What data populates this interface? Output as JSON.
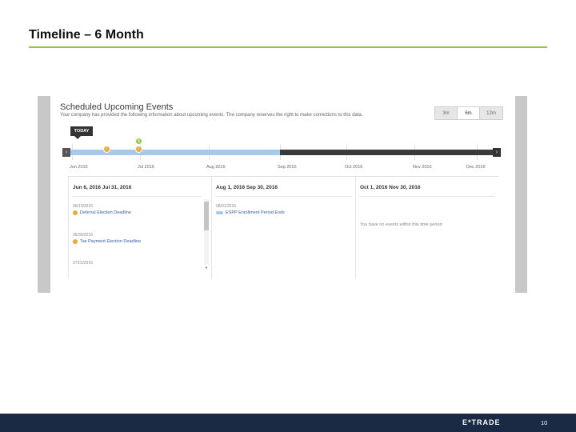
{
  "slide": {
    "title": "Timeline – 6 Month",
    "page_number": "10",
    "logo_text": "E*TRADE"
  },
  "panel": {
    "title": "Scheduled Upcoming Events",
    "subtitle": "Your company has provided the following information about upcoming events. The company reserves the right to make corrections to this data.",
    "range_buttons": [
      "3m",
      "6m",
      "12m"
    ],
    "active_range": "6m",
    "today_label": "TODAY"
  },
  "timeline": {
    "months": [
      "Jun 2016",
      "Jul 2016",
      "Aug 2016",
      "Sep 2016",
      "Oct 2016",
      "Nov 2016",
      "Dec 2016"
    ],
    "markers": [
      {
        "label": "!",
        "type": "warning"
      },
      {
        "label": "!",
        "type": "warning"
      },
      {
        "label": "$",
        "type": "payment"
      }
    ]
  },
  "columns": [
    {
      "header": "Jun 6, 2016   Jul 31, 2016",
      "events": [
        {
          "date": "06/10/2016",
          "label": "Deferral Election Deadline"
        },
        {
          "date": "06/30/2016",
          "label": "Tax Payment Election Deadline"
        },
        {
          "date": "07/01/2016",
          "label": ""
        }
      ]
    },
    {
      "header": "Aug 1, 2016   Sep 30, 2016",
      "events": [
        {
          "date": "08/01/2016",
          "label": "ESPP Enrollment Period Ends"
        }
      ]
    },
    {
      "header": "Oct 1, 2016   Nov 30, 2016",
      "events": [],
      "empty_text": "You have no events within this time period"
    }
  ],
  "colors": {
    "accent_green": "#8dc63f",
    "timeline_blue": "#a7c8ef",
    "marker_orange": "#f0a830",
    "footer_navy": "#1b2a44"
  }
}
